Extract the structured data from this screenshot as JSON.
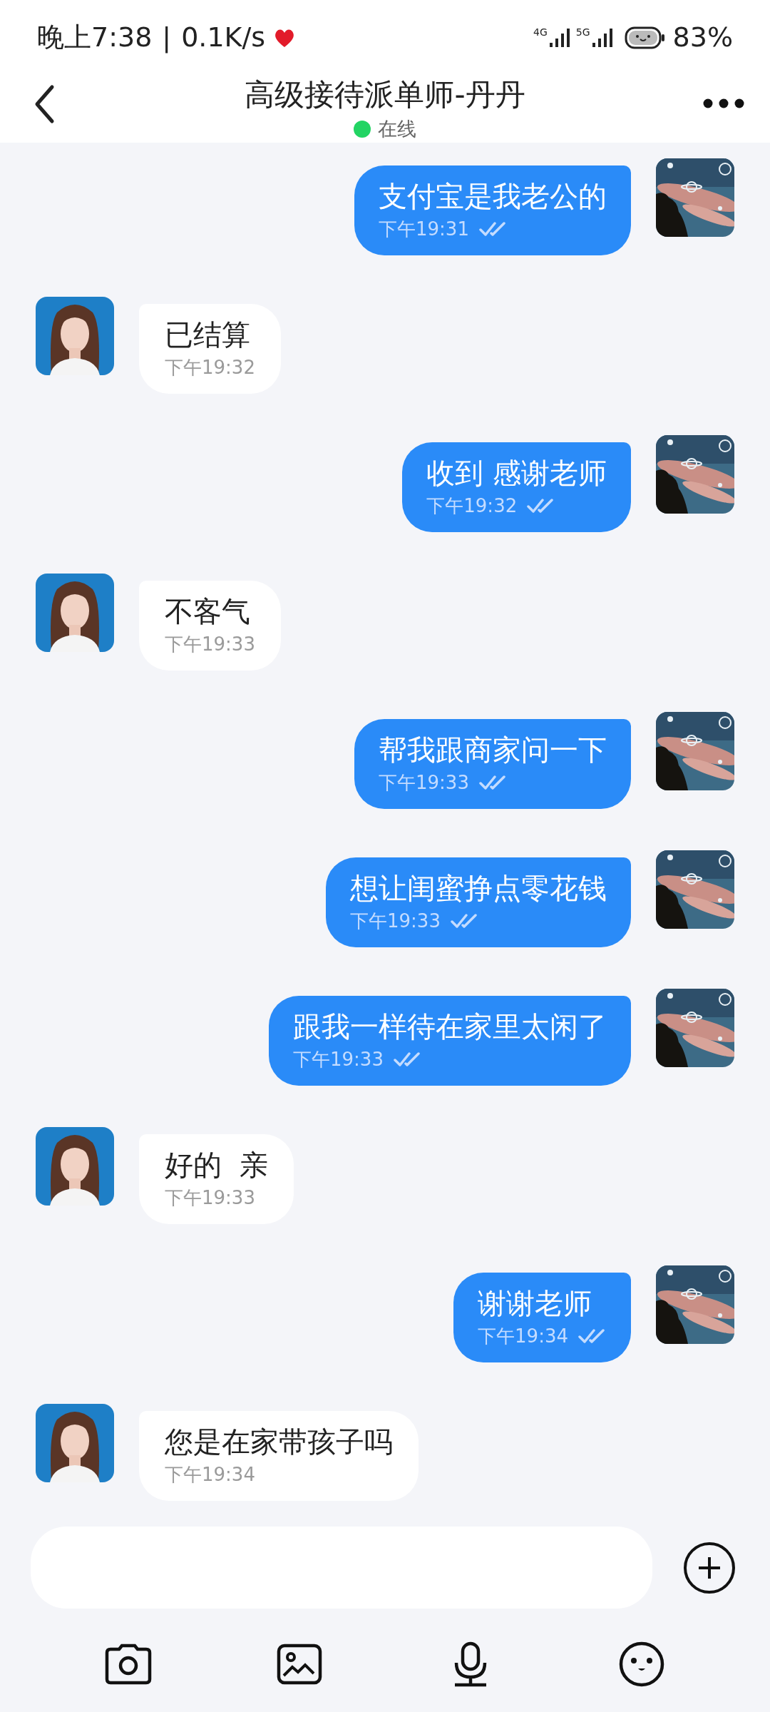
{
  "status_bar": {
    "time": "晚上7:38",
    "separator": "|",
    "speed": "0.1K/s",
    "network_1": "4G",
    "network_2": "5G",
    "battery": "83%"
  },
  "header": {
    "title": "高级接待派单师-丹丹",
    "presence": "在线"
  },
  "messages": [
    {
      "kind": "sent",
      "text": "支付宝是我老公的",
      "time": "下午19:31"
    },
    {
      "kind": "received",
      "text": "已结算",
      "time": "下午19:32"
    },
    {
      "kind": "sent",
      "text": "收到 感谢老师",
      "time": "下午19:32"
    },
    {
      "kind": "received",
      "text": "不客气",
      "time": "下午19:33"
    },
    {
      "kind": "sent",
      "text": "帮我跟商家问一下",
      "time": "下午19:33"
    },
    {
      "kind": "sent",
      "text": "想让闺蜜挣点零花钱",
      "time": "下午19:33"
    },
    {
      "kind": "sent",
      "text": "跟我一样待在家里太闲了",
      "time": "下午19:33"
    },
    {
      "kind": "received",
      "text": "好的  亲",
      "time": "下午19:33"
    },
    {
      "kind": "sent",
      "text": "谢谢老师",
      "time": "下午19:34"
    },
    {
      "kind": "received",
      "text": "您是在家带孩子吗",
      "time": "下午19:34"
    }
  ]
}
